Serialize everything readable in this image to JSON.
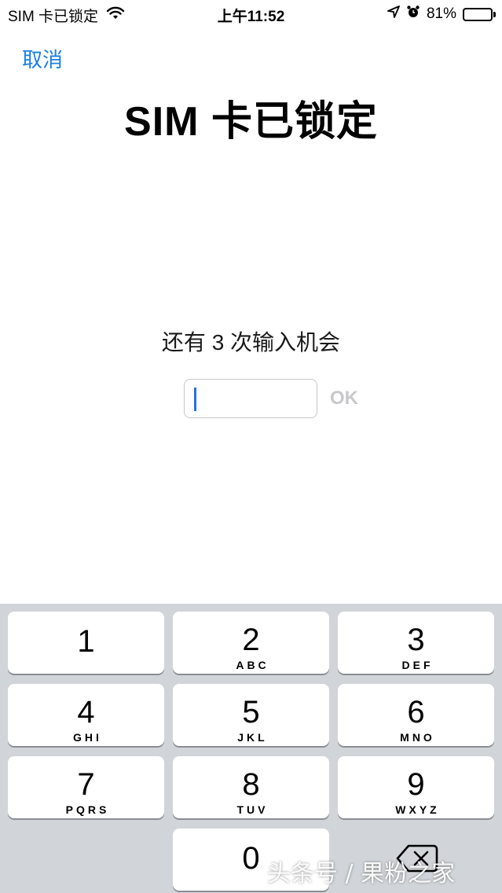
{
  "status_bar": {
    "carrier": "SIM 卡已锁定",
    "time": "上午11:52",
    "battery_percent": "81%",
    "battery_level": 0.81,
    "icons": [
      "wifi-icon",
      "location-icon",
      "alarm-icon",
      "battery-icon"
    ]
  },
  "nav": {
    "cancel_label": "取消"
  },
  "title": "SIM 卡已锁定",
  "attempts_text": "还有 3 次输入机会",
  "pin_field": {
    "value": "",
    "placeholder": ""
  },
  "ok_label": "OK",
  "keypad": {
    "keys": [
      {
        "digit": "1",
        "letters": ""
      },
      {
        "digit": "2",
        "letters": "ABC"
      },
      {
        "digit": "3",
        "letters": "DEF"
      },
      {
        "digit": "4",
        "letters": "GHI"
      },
      {
        "digit": "5",
        "letters": "JKL"
      },
      {
        "digit": "6",
        "letters": "MNO"
      },
      {
        "digit": "7",
        "letters": "PQRS"
      },
      {
        "digit": "8",
        "letters": "TUV"
      },
      {
        "digit": "9",
        "letters": "WXYZ"
      },
      {
        "digit": "0",
        "letters": ""
      }
    ],
    "delete_icon": "backspace-icon"
  },
  "watermark": "头条号 / 果粉之家",
  "colors": {
    "accent": "#1a7ee0",
    "caret": "#2b6fe0",
    "keypad_bg": "#d1d4d9",
    "ok_disabled": "#c8c8cc"
  }
}
